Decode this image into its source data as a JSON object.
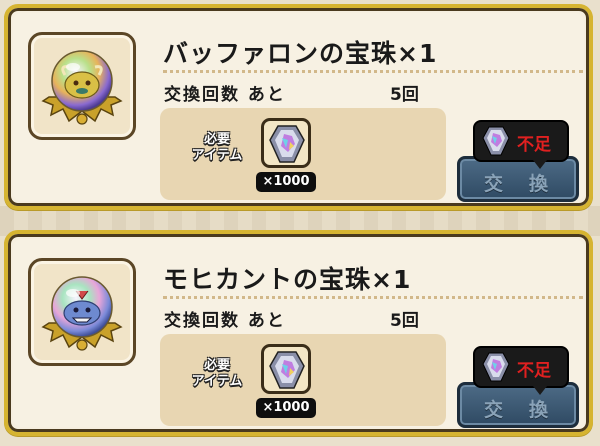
{
  "colors": {
    "border_gold": "#d6b431",
    "panel": "#f6efe0",
    "req_box": "#e8d6b2",
    "button": "#3b5872",
    "shortage_text": "#e02020"
  },
  "offers": [
    {
      "title": "バッファロンの宝珠×1",
      "count_label": "交換回数 あと",
      "count_value": "5回",
      "req_label_1": "必要",
      "req_label_2": "アイテム",
      "item_icon": "crystal-icon",
      "qty": "×1000",
      "shortage": "不足",
      "exchange_button": "交換",
      "orb_icon": "buffalon-orb-icon"
    },
    {
      "title": "モヒカントの宝珠×1",
      "count_label": "交換回数 あと",
      "count_value": "5回",
      "req_label_1": "必要",
      "req_label_2": "アイテム",
      "item_icon": "crystal-icon",
      "qty": "×1000",
      "shortage": "不足",
      "exchange_button": "交換",
      "orb_icon": "mohicant-orb-icon"
    }
  ]
}
